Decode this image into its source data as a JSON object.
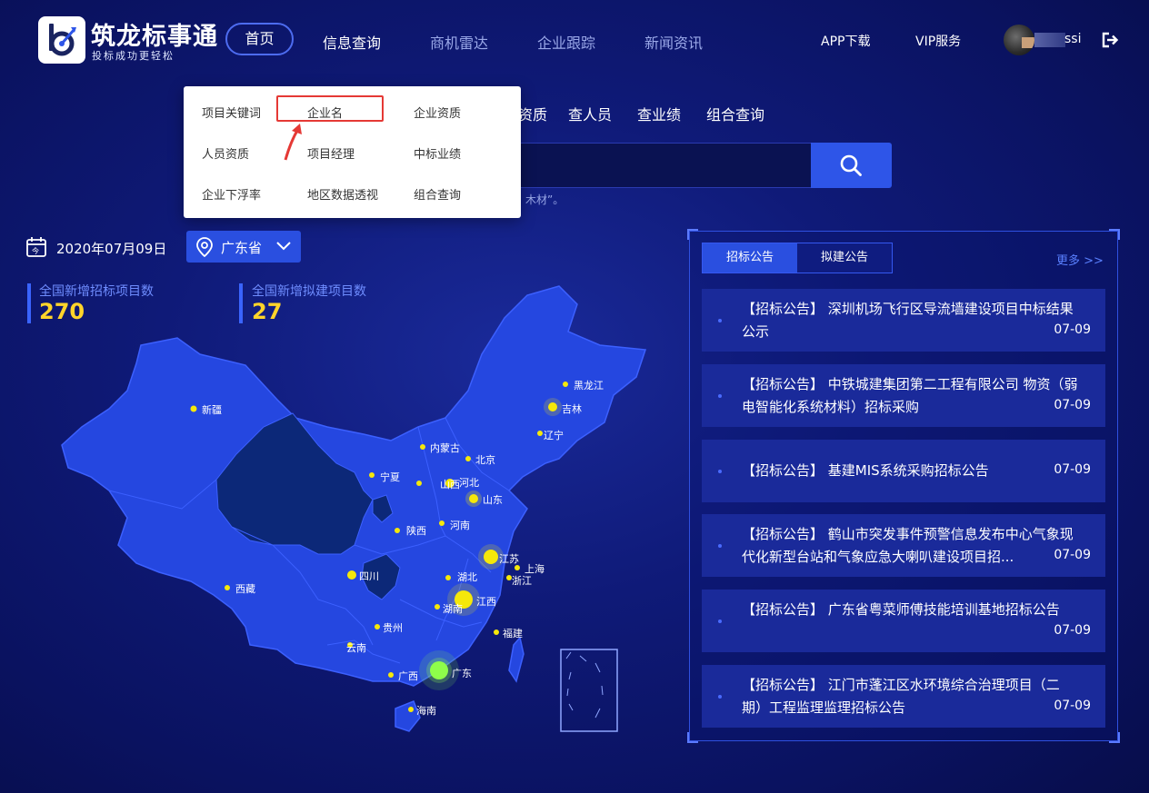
{
  "brand": {
    "name": "筑龙标事通",
    "slogan": "投标成功更轻松"
  },
  "nav": {
    "home": "首页",
    "items": [
      "信息查询",
      "商机雷达",
      "企业跟踪",
      "新闻资讯"
    ],
    "app_download": "APP下载",
    "vip": "VIP服务",
    "user_name": "ssi"
  },
  "query_tabs": [
    "资质",
    "查人员",
    "查业绩",
    "组合查询"
  ],
  "search": {
    "hint": "，木材”。"
  },
  "dropdown": {
    "rows": [
      [
        "项目关键词",
        "企业名",
        "企业资质"
      ],
      [
        "人员资质",
        "项目经理",
        "中标业绩"
      ],
      [
        "企业下浮率",
        "地区数据透视",
        "组合查询"
      ]
    ]
  },
  "date": {
    "text": "2020年07月09日"
  },
  "province": {
    "selected": "广东省"
  },
  "stats": [
    {
      "label": "全国新增招标项目数",
      "value": "270"
    },
    {
      "label": "全国新增拟建项目数",
      "value": "27"
    }
  ],
  "panel": {
    "tabs": [
      "招标公告",
      "拟建公告"
    ],
    "more": "更多 >>",
    "notices": [
      {
        "line1": "【招标公告】 深圳机场飞行区导流墙建设项目中标结果",
        "line2": "公示",
        "date": "07-09"
      },
      {
        "line1": "【招标公告】 中铁城建集团第二工程有限公司 物资（弱",
        "line2": "电智能化系统材料）招标采购",
        "date": "07-09"
      },
      {
        "line1": "【招标公告】 基建MIS系统采购招标公告",
        "line2": "",
        "date": "07-09"
      },
      {
        "line1": "【招标公告】 鹤山市突发事件预警信息发布中心气象现",
        "line2": "代化新型台站和气象应急大喇叭建设项目招...",
        "date": "07-09"
      },
      {
        "line1": "【招标公告】 广东省粤菜师傅技能培训基地招标公告",
        "line2": "",
        "date": "07-09"
      },
      {
        "line1": "【招标公告】 江门市蓬江区水环境综合治理项目（二",
        "line2": "期）工程监理监理招标公告",
        "date": "07-09"
      }
    ]
  },
  "map": {
    "provinces": [
      "新疆",
      "西藏",
      "内蒙古",
      "黑龙江",
      "吉林",
      "辽宁",
      "北京",
      "河北",
      "山西",
      "宁夏",
      "陕西",
      "河南",
      "山东",
      "江苏",
      "上海",
      "浙江",
      "湖北",
      "四川",
      "江西",
      "湖南",
      "贵州",
      "云南",
      "福建",
      "广西",
      "广东",
      "海南"
    ]
  },
  "colors": {
    "accent": "#2e55e8",
    "stat_value": "#ffd42a",
    "highlight_border": "#e53935"
  }
}
